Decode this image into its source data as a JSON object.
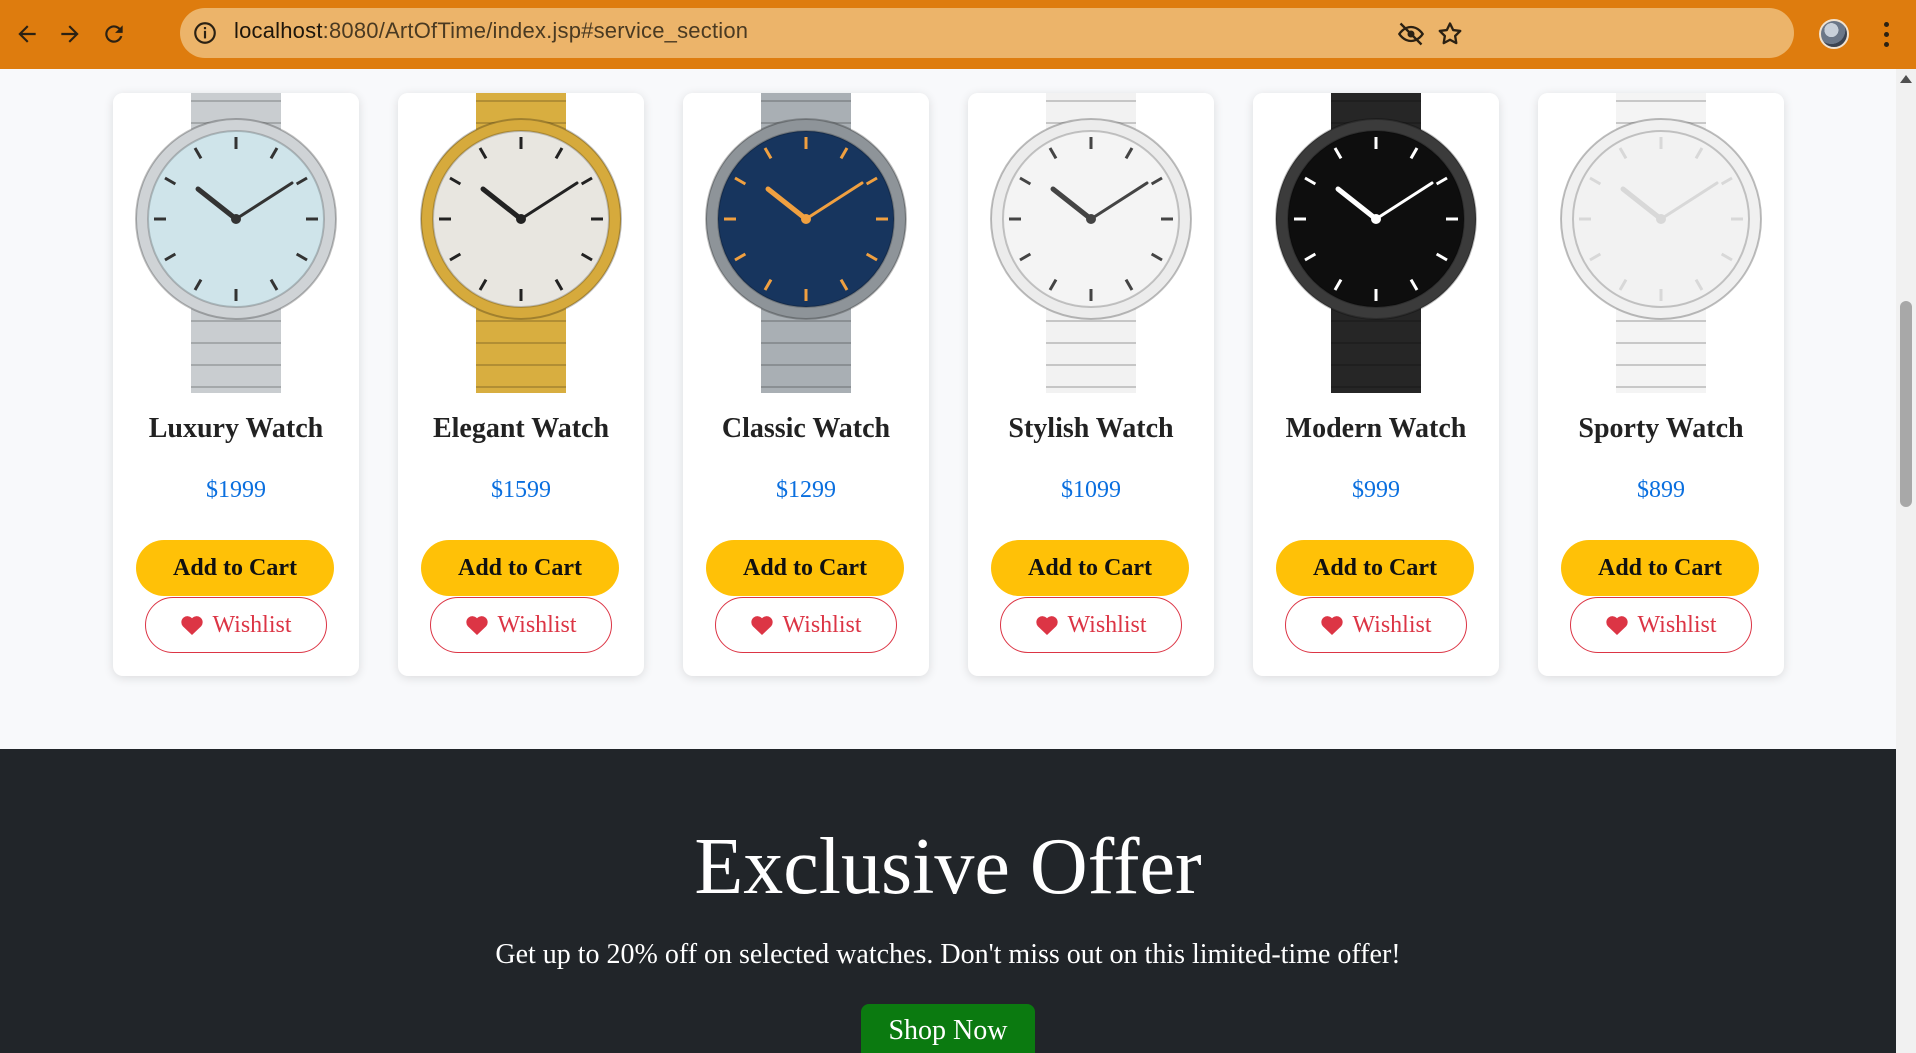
{
  "browser": {
    "url_host": "localhost",
    "url_rest": ":8080/ArtOfTime/index.jsp#service_section",
    "icons": [
      "back-arrow-icon",
      "forward-arrow-icon",
      "reload-icon",
      "site-info-icon",
      "eye-off-icon",
      "star-icon",
      "profile-avatar",
      "more-vert-icon"
    ]
  },
  "products": [
    {
      "title": "Luxury Watch",
      "price": "$1999",
      "cart_label": "Add to Cart",
      "wishlist_label": "Wishlist",
      "dial": "#cfe4ea",
      "case": "#cfd3d6",
      "strap": "#c9cdd0",
      "marks": "#333"
    },
    {
      "title": "Elegant Watch",
      "price": "$1599",
      "cart_label": "Add to Cart",
      "wishlist_label": "Wishlist",
      "dial": "#e8e6e0",
      "case": "#d6aa3c",
      "strap": "#d8ae40",
      "marks": "#222"
    },
    {
      "title": "Classic Watch",
      "price": "$1299",
      "cart_label": "Add to Cart",
      "wishlist_label": "Wishlist",
      "dial": "#17355e",
      "case": "#8e9499",
      "strap": "#a9afb4",
      "marks": "#f0a040"
    },
    {
      "title": "Stylish Watch",
      "price": "$1099",
      "cart_label": "Add to Cart",
      "wishlist_label": "Wishlist",
      "dial": "#f4f4f4",
      "case": "#ececec",
      "strap": "#f2f2f2",
      "marks": "#444"
    },
    {
      "title": "Modern Watch",
      "price": "$999",
      "cart_label": "Add to Cart",
      "wishlist_label": "Wishlist",
      "dial": "#0e0e0e",
      "case": "#3b3b3b",
      "strap": "#262626",
      "marks": "#ffffff"
    },
    {
      "title": "Sporty Watch",
      "price": "$899",
      "cart_label": "Add to Cart",
      "wishlist_label": "Wishlist",
      "dial": "#f2f2f2",
      "case": "#f0f0f0",
      "strap": "#f4f4f4",
      "marks": "#d8d8d8"
    }
  ],
  "offer": {
    "title": "Exclusive Offer",
    "subtitle": "Get up to 20% off on selected watches. Don't miss out on this limited-time offer!",
    "button_label": "Shop Now"
  },
  "colors": {
    "chrome": "#de7c0e",
    "cart_button": "#ffc107",
    "wishlist": "#dc3545",
    "price": "#0a6fdf",
    "offer_bg": "#212529",
    "shop_button": "#0b7a10"
  }
}
